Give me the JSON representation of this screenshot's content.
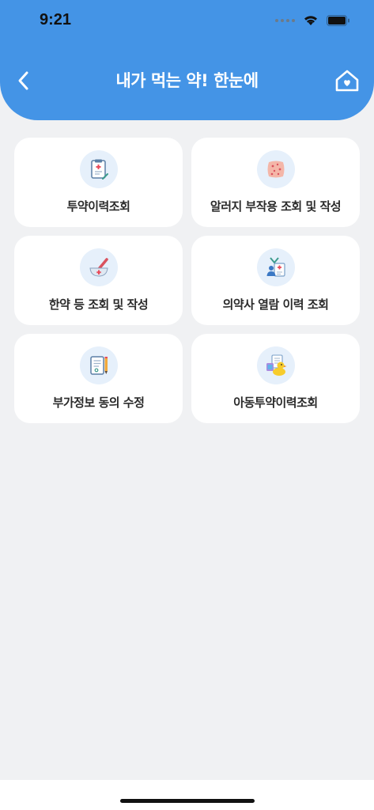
{
  "status_bar": {
    "time": "9:21"
  },
  "header": {
    "title": "내가 먹는 약! 한눈에"
  },
  "menu": [
    {
      "label": "투약이력조회",
      "icon": "prescription-clipboard-icon"
    },
    {
      "label": "알러지 부작용 조회 및 작성",
      "icon": "skin-rash-icon"
    },
    {
      "label": "한약 등 조회 및 작성",
      "icon": "mortar-pestle-icon"
    },
    {
      "label": "의약사 열람 이력 조회",
      "icon": "doctor-record-icon"
    },
    {
      "label": "부가정보 동의 수정",
      "icon": "document-pencil-icon"
    },
    {
      "label": "아동투약이력조회",
      "icon": "child-duck-icon"
    }
  ],
  "colors": {
    "header": "#4494e6",
    "background": "#f0f1f3",
    "card": "#ffffff"
  }
}
